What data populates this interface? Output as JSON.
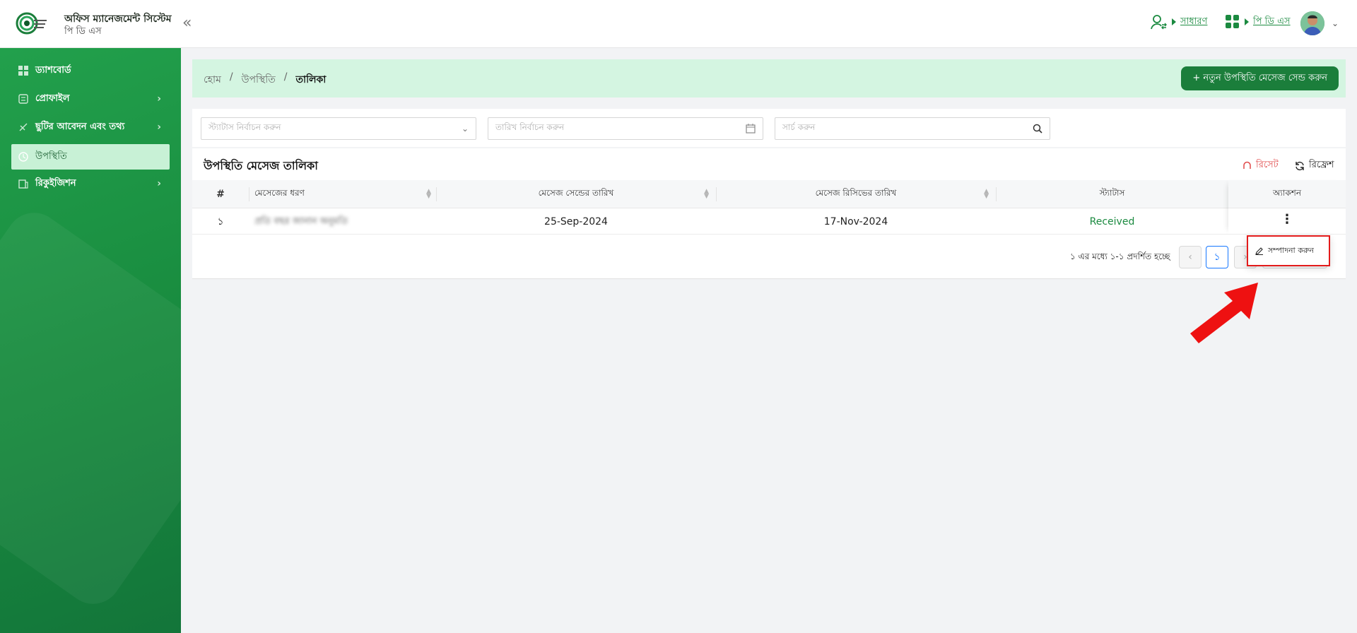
{
  "header": {
    "app_title": "অফিস ম্যানেজমেন্ট সিস্টেম",
    "app_subtitle": "পি ডি এস",
    "role_link": "সাধারণ",
    "office_link": "পি ডি এস"
  },
  "sidebar": {
    "items": [
      {
        "label": "ড্যাশবোর্ড"
      },
      {
        "label": "প্রোফাইল"
      },
      {
        "label": "ছুটির আবেদন এবং তথ্য"
      },
      {
        "label": "উপস্থিতি"
      },
      {
        "label": "রিকুইজিশন"
      }
    ]
  },
  "breadcrumb": {
    "home": "হোম",
    "section": "উপস্থিতি",
    "current": "তালিকা",
    "sep": "/"
  },
  "new_button": "+ নতুন উপস্থিতি মেসেজ সেন্ড করুন",
  "filters": {
    "status_placeholder": "স্ট্যাটাস নির্বাচন করুন",
    "date_placeholder": "তারিখ নির্বাচন করুন",
    "search_placeholder": "সার্চ করুন"
  },
  "table": {
    "title": "উপস্থিতি মেসেজ তালিকা",
    "reset": "রিসেট",
    "refresh": "রিফ্রেশ",
    "columns": [
      "#",
      "মেসেজের ধরণ",
      "মেসেজ সেন্ডের তারিখ",
      "মেসেজ রিসিভের তারিখ",
      "স্ট্যাটাস",
      "অ্যাকশন"
    ],
    "rows": [
      {
        "index": "১",
        "type": "প্রতি বছর জানান অনুমতি",
        "sent_date": "25-Sep-2024",
        "received_date": "17-Nov-2024",
        "status": "Received"
      }
    ]
  },
  "pagination": {
    "info": "১ এর মধ্যে ১-১ প্রদর্শিত হচ্ছে",
    "current_page": "১"
  },
  "action_menu": {
    "edit": "সম্পাদনা করুন"
  },
  "colors": {
    "brand_green": "#1b7e3b",
    "sidebar_green": "#1e9447",
    "highlight_red": "#e31b1b",
    "status_green": "#1b8a40"
  },
  "icons": [
    "logo",
    "double-chevron-left-icon",
    "user-switch-icon",
    "grid-apps-icon",
    "dashboard-icon",
    "profile-icon",
    "leave-icon",
    "clock-icon",
    "requisition-icon",
    "chevron-right-icon",
    "calendar-icon",
    "search-icon",
    "reset-icon",
    "refresh-icon",
    "sort-icon",
    "kebab-icon",
    "edit-icon",
    "arrow-pointer-icon"
  ]
}
